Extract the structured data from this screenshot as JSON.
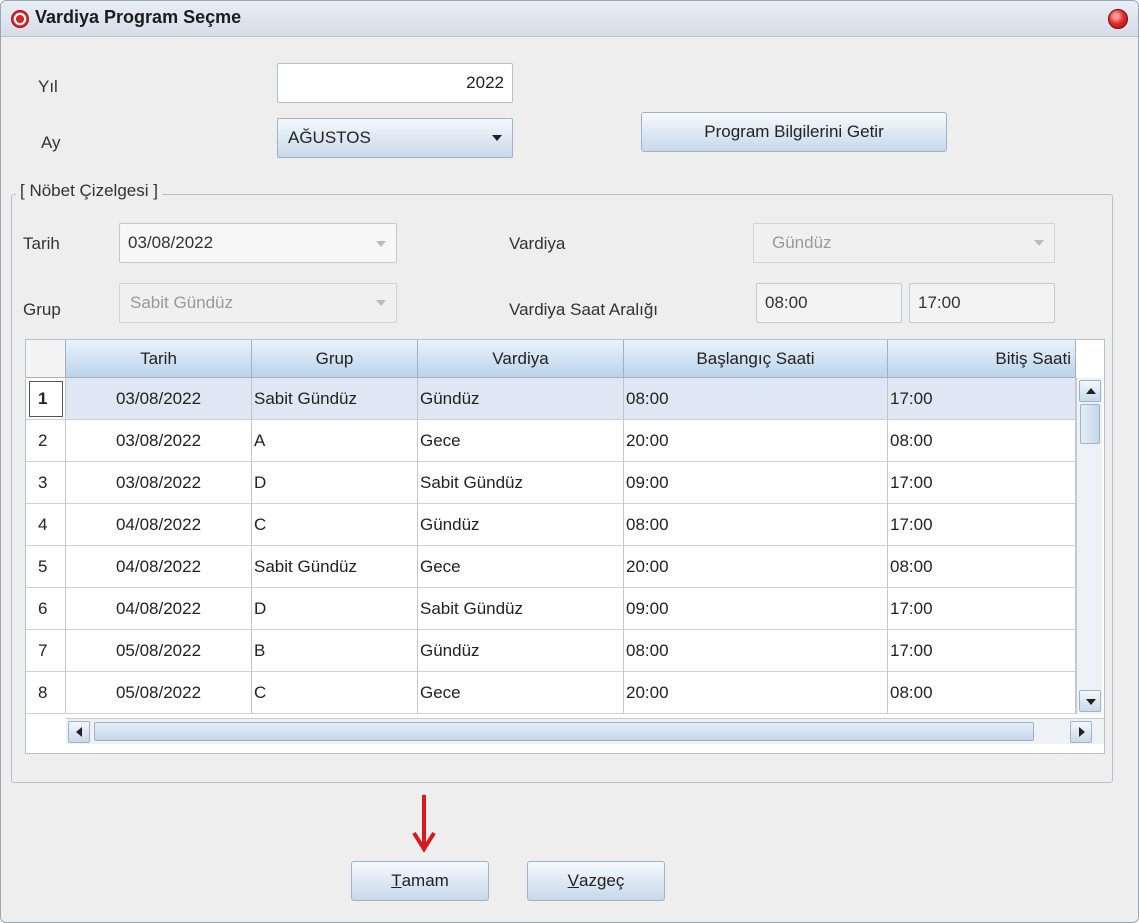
{
  "window": {
    "title": "Vardiya Program Seçme"
  },
  "form": {
    "yil_label": "Yıl",
    "yil_value": "2022",
    "ay_label": "Ay",
    "ay_value": "AĞUSTOS",
    "fetch_button": "Program Bilgilerini Getir"
  },
  "panel": {
    "legend": "[ Nöbet Çizelgesi ]",
    "tarih_label": "Tarih",
    "tarih_value": "03/08/2022",
    "vardiya_label": "Vardiya",
    "vardiya_value": "Gündüz",
    "grup_label": "Grup",
    "grup_value": "Sabit Gündüz",
    "saat_label": "Vardiya Saat Aralığı",
    "saat_start": "08:00",
    "saat_end": "17:00"
  },
  "table": {
    "columns": [
      "Tarih",
      "Grup",
      "Vardiya",
      "Başlangıç Saati",
      "Bitiş Saati"
    ],
    "rows": [
      {
        "no": "1",
        "tarih": "03/08/2022",
        "grup": "Sabit Gündüz",
        "vardiya": "Gündüz",
        "baslangic": "08:00",
        "bitis": "17:00"
      },
      {
        "no": "2",
        "tarih": "03/08/2022",
        "grup": "A",
        "vardiya": "Gece",
        "baslangic": "20:00",
        "bitis": "08:00"
      },
      {
        "no": "3",
        "tarih": "03/08/2022",
        "grup": "D",
        "vardiya": "Sabit Gündüz",
        "baslangic": "09:00",
        "bitis": "17:00"
      },
      {
        "no": "4",
        "tarih": "04/08/2022",
        "grup": "C",
        "vardiya": "Gündüz",
        "baslangic": "08:00",
        "bitis": "17:00"
      },
      {
        "no": "5",
        "tarih": "04/08/2022",
        "grup": "Sabit Gündüz",
        "vardiya": "Gece",
        "baslangic": "20:00",
        "bitis": "08:00"
      },
      {
        "no": "6",
        "tarih": "04/08/2022",
        "grup": "D",
        "vardiya": "Sabit Gündüz",
        "baslangic": "09:00",
        "bitis": "17:00"
      },
      {
        "no": "7",
        "tarih": "05/08/2022",
        "grup": "B",
        "vardiya": "Gündüz",
        "baslangic": "08:00",
        "bitis": "17:00"
      },
      {
        "no": "8",
        "tarih": "05/08/2022",
        "grup": "C",
        "vardiya": "Gece",
        "baslangic": "20:00",
        "bitis": "08:00"
      }
    ]
  },
  "buttons": {
    "ok_first": "T",
    "ok_rest": "amam",
    "cancel_first": "V",
    "cancel_rest": "azgeç"
  },
  "colors": {
    "selected_row": "#dde8f4",
    "annotation_arrow": "#d8191f"
  }
}
